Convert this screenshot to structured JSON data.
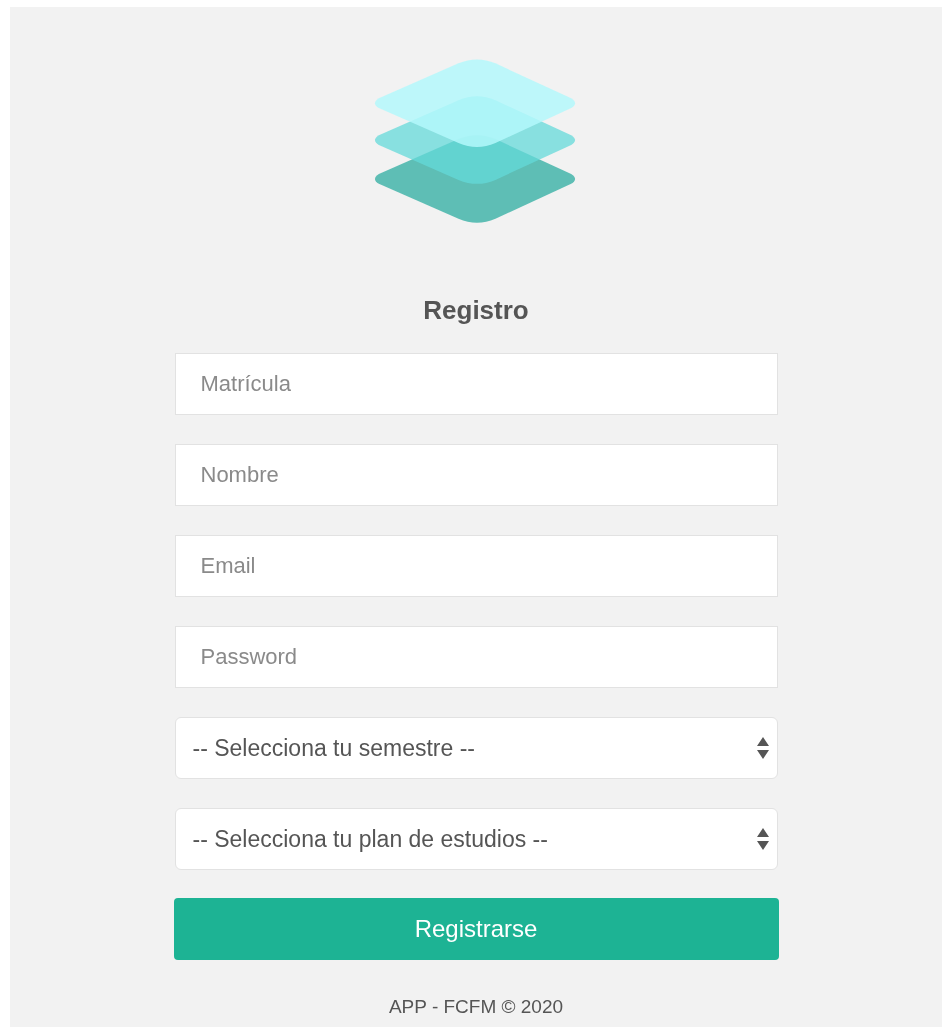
{
  "form": {
    "title": "Registro",
    "fields": [
      {
        "kind": "input",
        "placeholder": "Matrícula"
      },
      {
        "kind": "input",
        "placeholder": "Nombre"
      },
      {
        "kind": "input",
        "placeholder": "Email"
      },
      {
        "kind": "input",
        "placeholder": "Password"
      },
      {
        "kind": "select",
        "value": "-- Selecciona tu semestre --"
      },
      {
        "kind": "select",
        "value": "-- Selecciona tu plan de estudios --"
      }
    ],
    "submit": "Registrarse"
  },
  "footer": "APP - FCFM © 2020"
}
